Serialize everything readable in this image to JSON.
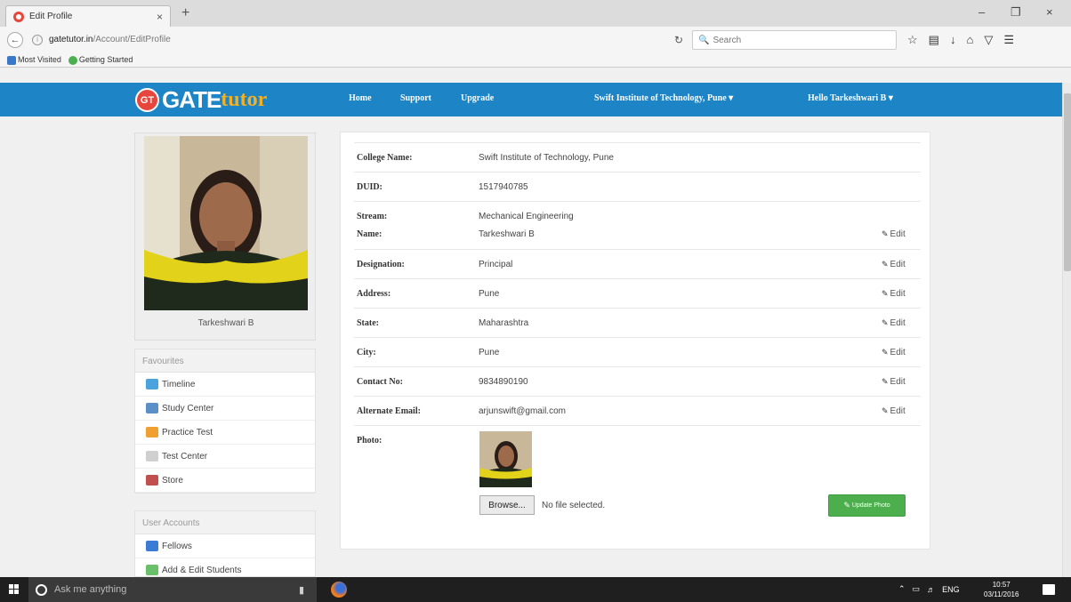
{
  "browser": {
    "tab_title": "Edit Profile",
    "tab_close": "×",
    "new_tab": "+",
    "url_host": "gatetutor.in",
    "url_path": "/Account/EditProfile",
    "search_placeholder": "Search",
    "bookmarks": [
      "Most Visited",
      "Getting Started"
    ],
    "window_controls": [
      "–",
      "❐",
      "×"
    ]
  },
  "site": {
    "logo_badge": "GT",
    "logo_gate": "GATE",
    "logo_tutor": "tutor",
    "nav": {
      "home": "Home",
      "support": "Support",
      "upgrade": "Upgrade",
      "college": "Swift Institute of Technology, Pune ▾",
      "user": "Hello Tarkeshwari B ▾"
    }
  },
  "profile": {
    "name": "Tarkeshwari B"
  },
  "favourites": {
    "heading": "Favourites",
    "items": [
      "Timeline",
      "Study Center",
      "Practice Test",
      "Test Center",
      "Store"
    ]
  },
  "user_accounts": {
    "heading": "User Accounts",
    "items": [
      "Fellows",
      "Add & Edit Students"
    ]
  },
  "form": {
    "rows": [
      {
        "label": "College Name:",
        "value": "Swift Institute of Technology, Pune"
      },
      {
        "label": "DUID:",
        "value": "1517940785"
      },
      {
        "label": "Stream:",
        "value": "Mechanical Engineering"
      },
      {
        "label": "Name:",
        "value": "Tarkeshwari B",
        "edit": "Edit"
      },
      {
        "label": "Designation:",
        "value": "Principal",
        "edit": "Edit"
      },
      {
        "label": "Address:",
        "value": "Pune",
        "edit": "Edit"
      },
      {
        "label": "State:",
        "value": "Maharashtra",
        "edit": "Edit"
      },
      {
        "label": "City:",
        "value": "Pune",
        "edit": "Edit"
      },
      {
        "label": "Contact No:",
        "value": "9834890190",
        "edit": "Edit"
      },
      {
        "label": "Alternate Email:",
        "value": "arjunswift@gmail.com",
        "edit": "Edit"
      },
      {
        "label": "Photo:"
      }
    ],
    "browse_label": "Browse...",
    "no_file": "No file selected.",
    "update_photo": "Update Photo"
  },
  "taskbar": {
    "search_placeholder": "Ask me anything",
    "tray_lang": "ENG",
    "clock_time": "10:57",
    "clock_date": "03/11/2016"
  },
  "colors": {
    "header_blue": "#1d84c6",
    "tutor_orange": "#f5b021",
    "update_green": "#4cae4c"
  }
}
